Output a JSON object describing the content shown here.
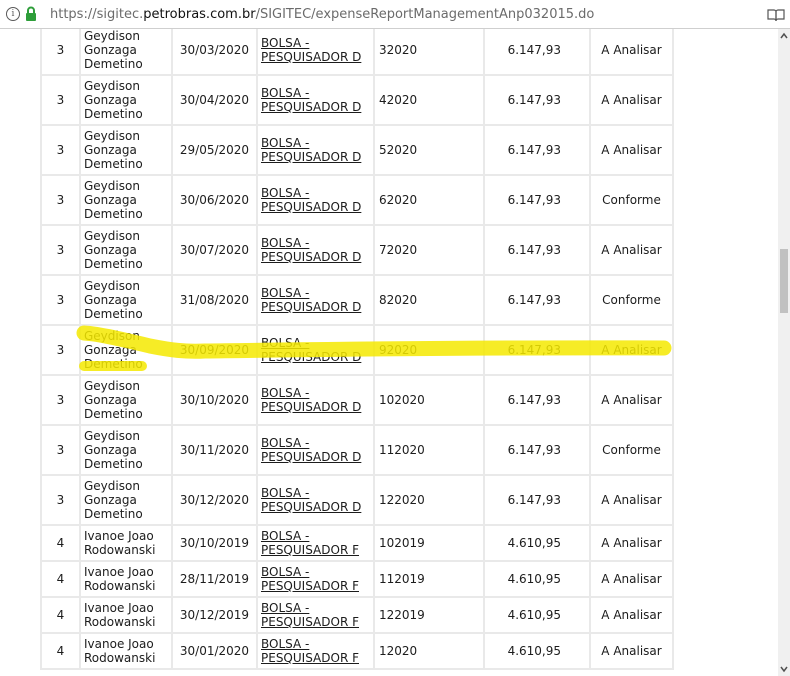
{
  "browser": {
    "url_prefix": "https://sigitec.",
    "url_domain": "petrobras.com.br",
    "url_path": "/SIGITEC/expenseReportManagementAnp032015.do"
  },
  "highlight_color": "#f5e900",
  "rows": [
    {
      "id": "3",
      "name": [
        "Geydison",
        "Gonzaga",
        "Demetino"
      ],
      "date": "30/03/2020",
      "item": [
        "BOLSA -",
        "PESQUISADOR D"
      ],
      "ref": "32020",
      "value": "6.147,93",
      "status": "A Analisar"
    },
    {
      "id": "3",
      "name": [
        "Geydison",
        "Gonzaga",
        "Demetino"
      ],
      "date": "30/04/2020",
      "item": [
        "BOLSA -",
        "PESQUISADOR D"
      ],
      "ref": "42020",
      "value": "6.147,93",
      "status": "A Analisar"
    },
    {
      "id": "3",
      "name": [
        "Geydison",
        "Gonzaga",
        "Demetino"
      ],
      "date": "29/05/2020",
      "item": [
        "BOLSA -",
        "PESQUISADOR D"
      ],
      "ref": "52020",
      "value": "6.147,93",
      "status": "A Analisar"
    },
    {
      "id": "3",
      "name": [
        "Geydison",
        "Gonzaga",
        "Demetino"
      ],
      "date": "30/06/2020",
      "item": [
        "BOLSA -",
        "PESQUISADOR D"
      ],
      "ref": "62020",
      "value": "6.147,93",
      "status": "Conforme"
    },
    {
      "id": "3",
      "name": [
        "Geydison",
        "Gonzaga",
        "Demetino"
      ],
      "date": "30/07/2020",
      "item": [
        "BOLSA -",
        "PESQUISADOR D"
      ],
      "ref": "72020",
      "value": "6.147,93",
      "status": "A Analisar"
    },
    {
      "id": "3",
      "name": [
        "Geydison",
        "Gonzaga",
        "Demetino"
      ],
      "date": "31/08/2020",
      "item": [
        "BOLSA -",
        "PESQUISADOR D"
      ],
      "ref": "82020",
      "value": "6.147,93",
      "status": "Conforme"
    },
    {
      "id": "3",
      "name": [
        "Geydison",
        "Gonzaga",
        "Demetino"
      ],
      "date": "30/09/2020",
      "item": [
        "BOLSA -",
        "PESQUISADOR D"
      ],
      "ref": "92020",
      "value": "6.147,93",
      "status": "A Analisar"
    },
    {
      "id": "3",
      "name": [
        "Geydison",
        "Gonzaga",
        "Demetino"
      ],
      "date": "30/10/2020",
      "item": [
        "BOLSA -",
        "PESQUISADOR D"
      ],
      "ref": "102020",
      "value": "6.147,93",
      "status": "A Analisar"
    },
    {
      "id": "3",
      "name": [
        "Geydison",
        "Gonzaga",
        "Demetino"
      ],
      "date": "30/11/2020",
      "item": [
        "BOLSA -",
        "PESQUISADOR D"
      ],
      "ref": "112020",
      "value": "6.147,93",
      "status": "Conforme"
    },
    {
      "id": "3",
      "name": [
        "Geydison",
        "Gonzaga",
        "Demetino"
      ],
      "date": "30/12/2020",
      "item": [
        "BOLSA -",
        "PESQUISADOR D"
      ],
      "ref": "122020",
      "value": "6.147,93",
      "status": "A Analisar"
    },
    {
      "id": "4",
      "name": [
        "Ivanoe Joao",
        "Rodowanski"
      ],
      "date": "30/10/2019",
      "item": [
        "BOLSA -",
        "PESQUISADOR F"
      ],
      "ref": "102019",
      "value": "4.610,95",
      "status": "A Analisar"
    },
    {
      "id": "4",
      "name": [
        "Ivanoe Joao",
        "Rodowanski"
      ],
      "date": "28/11/2019",
      "item": [
        "BOLSA -",
        "PESQUISADOR F"
      ],
      "ref": "112019",
      "value": "4.610,95",
      "status": "A Analisar"
    },
    {
      "id": "4",
      "name": [
        "Ivanoe Joao",
        "Rodowanski"
      ],
      "date": "30/12/2019",
      "item": [
        "BOLSA -",
        "PESQUISADOR F"
      ],
      "ref": "122019",
      "value": "4.610,95",
      "status": "A Analisar"
    },
    {
      "id": "4",
      "name": [
        "Ivanoe Joao",
        "Rodowanski"
      ],
      "date": "30/01/2020",
      "item": [
        "BOLSA -",
        "PESQUISADOR F"
      ],
      "ref": "12020",
      "value": "4.610,95",
      "status": "A Analisar"
    }
  ]
}
